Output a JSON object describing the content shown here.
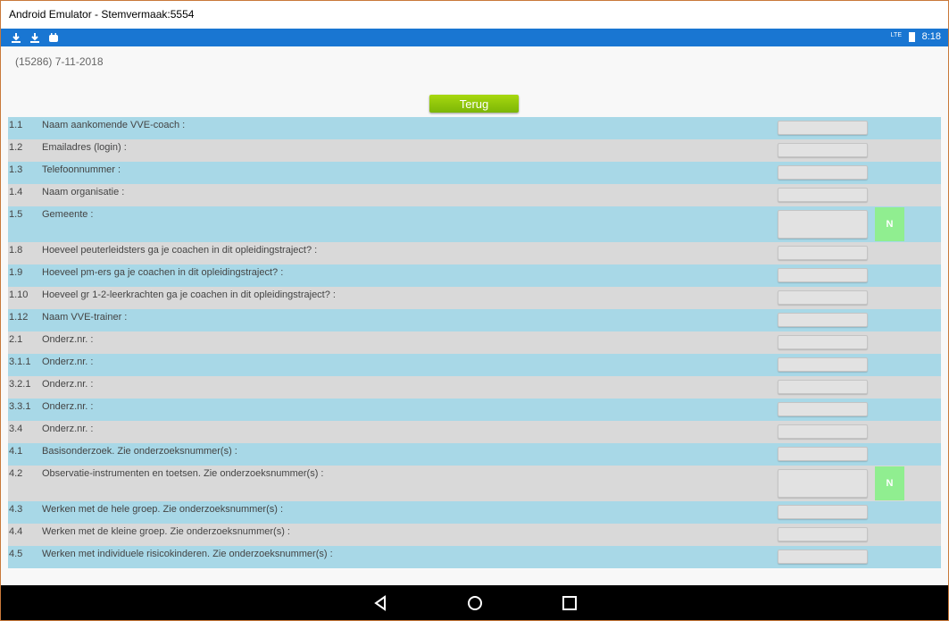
{
  "window": {
    "title": "Android Emulator - Stemvermaak:5554"
  },
  "statusbar": {
    "time": "8:18",
    "network": "LTE",
    "icons": [
      "download-icon",
      "download-icon",
      "android-icon"
    ]
  },
  "header": {
    "info": "(15286) 7-11-2018",
    "back_label": "Terug"
  },
  "rows": [
    {
      "num": "1.1",
      "label": "Naam aankomende VVE-coach :",
      "color": "blue",
      "tall": false,
      "n_button": ""
    },
    {
      "num": "1.2",
      "label": "Emailadres (login) :",
      "color": "grey",
      "tall": false,
      "n_button": ""
    },
    {
      "num": "1.3",
      "label": "Telefoonnummer :",
      "color": "blue",
      "tall": false,
      "n_button": ""
    },
    {
      "num": "1.4",
      "label": "Naam organisatie :",
      "color": "grey",
      "tall": false,
      "n_button": ""
    },
    {
      "num": "1.5",
      "label": "Gemeente :",
      "color": "blue",
      "tall": true,
      "n_button": "N"
    },
    {
      "num": "1.8",
      "label": "Hoeveel peuterleidsters ga je coachen in dit opleidingstraject? :",
      "color": "grey",
      "tall": false,
      "n_button": ""
    },
    {
      "num": "1.9",
      "label": "Hoeveel pm-ers ga je coachen in dit opleidingstraject? :",
      "color": "blue",
      "tall": false,
      "n_button": ""
    },
    {
      "num": "1.10",
      "label": "Hoeveel gr 1-2-leerkrachten ga je coachen in dit opleidingstraject? :",
      "color": "grey",
      "tall": false,
      "n_button": ""
    },
    {
      "num": "1.12",
      "label": "Naam VVE-trainer :",
      "color": "blue",
      "tall": false,
      "n_button": ""
    },
    {
      "num": "2.1",
      "label": "Onderz.nr. :",
      "color": "grey",
      "tall": false,
      "n_button": ""
    },
    {
      "num": "3.1.1",
      "label": "Onderz.nr. :",
      "color": "blue",
      "tall": false,
      "n_button": ""
    },
    {
      "num": "3.2.1",
      "label": "Onderz.nr. :",
      "color": "grey",
      "tall": false,
      "n_button": ""
    },
    {
      "num": "3.3.1",
      "label": "Onderz.nr. :",
      "color": "blue",
      "tall": false,
      "n_button": ""
    },
    {
      "num": "3.4",
      "label": "Onderz.nr. :",
      "color": "grey",
      "tall": false,
      "n_button": ""
    },
    {
      "num": "4.1",
      "label": "Basisonderzoek. Zie onderzoeksnummer(s) :",
      "color": "blue",
      "tall": false,
      "n_button": ""
    },
    {
      "num": "4.2",
      "label": "Observatie-instrumenten en toetsen. Zie onderzoeksnummer(s) :",
      "color": "grey",
      "tall": true,
      "n_button": "N"
    },
    {
      "num": "4.3",
      "label": "Werken met de hele groep. Zie onderzoeksnummer(s) :",
      "color": "blue",
      "tall": false,
      "n_button": ""
    },
    {
      "num": "4.4",
      "label": "Werken met de kleine groep. Zie onderzoeksnummer(s) :",
      "color": "grey",
      "tall": false,
      "n_button": ""
    },
    {
      "num": "4.5",
      "label": "Werken met individuele risicokinderen. Zie onderzoeksnummer(s) :",
      "color": "blue",
      "tall": false,
      "n_button": ""
    }
  ]
}
